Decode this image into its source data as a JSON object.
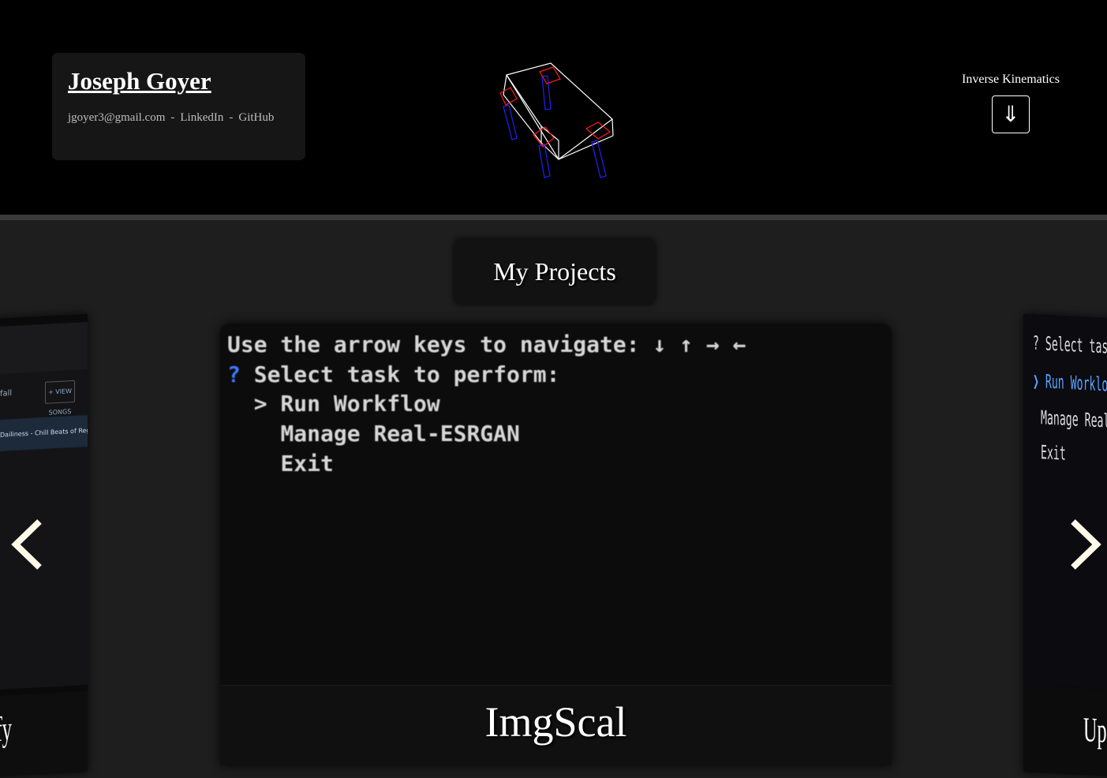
{
  "header": {
    "name": "Joseph Goyer",
    "email": "jgoyer3@gmail.com",
    "separator": "-",
    "linkedin": "LinkedIn",
    "github": "GitHub",
    "ik_label": "Inverse Kinematics",
    "ik_button": "⇓"
  },
  "projects": {
    "title": "My Projects",
    "current": {
      "title": "ImgScal",
      "terminal_lines": [
        "Use the arrow keys to navigate: ↓ ↑ → ←",
        "Select task to perform:",
        "> Run Workflow",
        "Manage Real-ESRGAN",
        "Exit"
      ],
      "prompt_glyph": "?"
    },
    "prev": {
      "caption": "ify",
      "pill": "+ VIEW SONGS",
      "row1": "fall",
      "row2": "Dailiness - Chill Beats of Regard"
    },
    "next": {
      "caption": "Upsc",
      "lines": [
        "? Select task to p",
        "❯ Run Workload",
        "Manage Real-ESRGA",
        "Exit"
      ]
    }
  },
  "colors": {
    "header_bg": "#000000",
    "section_bg": "#1e1e1e",
    "accent_blue": "#3b78ff",
    "robot_red": "#e01010",
    "robot_blue": "#1010e0"
  }
}
